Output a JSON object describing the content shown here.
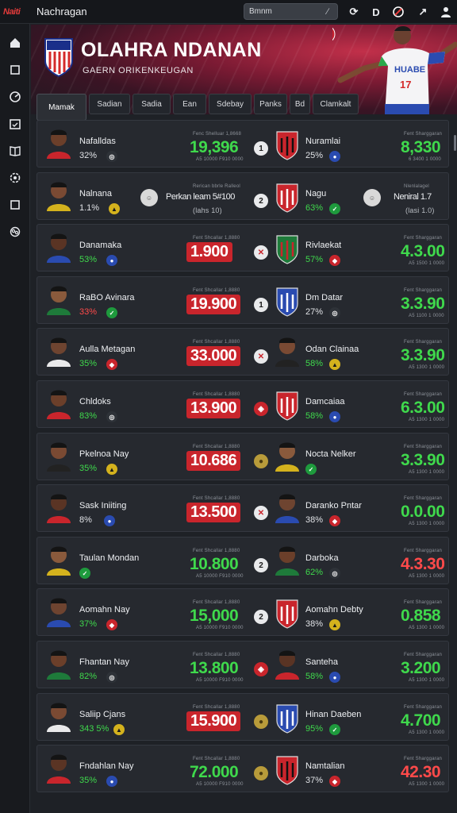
{
  "app": {
    "logo_text": "Naiti",
    "title": "Nachragan"
  },
  "search": {
    "value": "Bmnm"
  },
  "topbar_icons": [
    "refresh-icon",
    "d-icon",
    "brand-icon",
    "arrow-icon",
    "user-icon"
  ],
  "sidebar_icons": [
    "home-icon",
    "square-icon",
    "stats-icon",
    "calendar-icon",
    "book-icon",
    "settings-icon",
    "box-icon",
    "network-icon"
  ],
  "banner": {
    "title": "OLAHRA NDANAN",
    "subtitle": "GAERN ORIKENKEUGAN",
    "jersey_text": "HUABE",
    "jersey_number": "17"
  },
  "tabs": [
    "Mamak",
    "Sadian",
    "Sadia",
    "Ean",
    "Sdebay",
    "Panks",
    "Bd",
    "Clamkalt"
  ],
  "colors": {
    "green": "#3fd94c",
    "red": "#ff4a4a",
    "boxed_red": "#c9252c",
    "accent_blue": "#2a4bb0"
  },
  "matches": [
    {
      "left_name": "Nafalldas",
      "left_pct": "32%",
      "caption": "Fenc Shelluar 1,8668",
      "value": "19,396",
      "value_style": "green",
      "sub": "A5 10000 F910 0000",
      "mid": "1",
      "right_name": "Nuramlai",
      "right_pct": "25%",
      "right_caption": "Fent Sharggaran",
      "right_value": "8,330",
      "right_style": "green",
      "right_sub": "6 3400 1 0000"
    },
    {
      "left_name": "Nalnana",
      "left_pct": "1.1%",
      "caption": "Rerican bbrle Ralleol",
      "value": "Perkan leam 5#100",
      "value_style": "text",
      "sub": "(lahs 10)",
      "mid": "2",
      "right_name": "Nagu",
      "right_pct": "63%",
      "right_caption": "Nlenlalagel",
      "right_value": "Neniral 1.7",
      "right_style": "text",
      "right_sub": "(lasi 1.0)"
    },
    {
      "left_name": "Danamaka",
      "left_pct": "53%",
      "caption": "Fent Shcallar 1,8880",
      "value": "1.900",
      "value_style": "boxed",
      "sub": "",
      "mid": "x",
      "right_name": "Rivlaekat",
      "right_pct": "57%",
      "right_caption": "Fent Sharggaran",
      "right_value": "4.3.00",
      "right_style": "green",
      "right_sub": "A5 1500 1 0000"
    },
    {
      "left_name": "RaBO Avinara",
      "left_pct": "33%",
      "caption": "Fent Shcallar 1,8880",
      "value": "19.900",
      "value_style": "boxed",
      "sub": "",
      "mid": "1",
      "right_name": "Dm Datar",
      "right_pct": "27%",
      "right_caption": "Fent Sharggaran",
      "right_value": "3.3.90",
      "right_style": "green",
      "right_sub": "A5 1100 1 0000"
    },
    {
      "left_name": "Aulla Metagan",
      "left_pct": "35%",
      "caption": "Fent Shcallar 1,8880",
      "value": "33.000",
      "value_style": "boxed",
      "sub": "",
      "mid": "x",
      "right_name": "Odan Clainaa",
      "right_pct": "58%",
      "right_caption": "Fent Sharggaran",
      "right_value": "3.3.90",
      "right_style": "green",
      "right_sub": "A5 1300 1 0000"
    },
    {
      "left_name": "Chldoks",
      "left_pct": "83%",
      "caption": "Fent Shcallar 1,8880",
      "value": "13.900",
      "value_style": "boxed",
      "sub": "",
      "mid": "crest",
      "right_name": "Damcaiaa",
      "right_pct": "58%",
      "right_caption": "Fent Sharggaran",
      "right_value": "6.3.00",
      "right_style": "green",
      "right_sub": "A5 1300 1 0000"
    },
    {
      "left_name": "Pkelnoa Nay",
      "left_pct": "35%",
      "caption": "Fent Shcallar 1,8880",
      "value": "10.686",
      "value_style": "boxed",
      "sub": "",
      "mid": "ball",
      "right_name": "Nocta Nelker",
      "right_pct": "",
      "right_caption": "Fent Sharggaran",
      "right_value": "3.3.90",
      "right_style": "green",
      "right_sub": "A5 1300 1 0000"
    },
    {
      "left_name": "Sask Iniiting",
      "left_pct": "8%",
      "caption": "Fent Shcallar 1,8880",
      "value": "13.500",
      "value_style": "boxed",
      "sub": "",
      "mid": "x",
      "right_name": "Daranko Pntar",
      "right_pct": "38%",
      "right_caption": "Fent Sharggaran",
      "right_value": "0.0.00",
      "right_style": "green",
      "right_sub": "A5 1300 1 0000"
    },
    {
      "left_name": "Taulan Mondan",
      "left_pct": "",
      "caption": "Fent Shcallar 1,8880",
      "value": "10.800",
      "value_style": "green",
      "sub": "A5 10000 F910 0000",
      "mid": "2",
      "right_name": "Darboka",
      "right_pct": "62%",
      "right_caption": "Fent Sharggaran",
      "right_value": "4.3.30",
      "right_style": "red",
      "right_sub": "A5 1300 1 0000"
    },
    {
      "left_name": "Aomahn Nay",
      "left_pct": "37%",
      "caption": "Fent Shcallar 1,8880",
      "value": "15,000",
      "value_style": "green",
      "sub": "A5 10000 F910 0000",
      "mid": "2",
      "right_name": "Aomahn Debty",
      "right_pct": "38%",
      "right_caption": "Fent Sharggaran",
      "right_value": "0.858",
      "right_style": "green",
      "right_sub": "A5 1300 1 0000"
    },
    {
      "left_name": "Fhantan Nay",
      "left_pct": "82%",
      "caption": "Fent Shcallar 1,8880",
      "value": "13.800",
      "value_style": "green",
      "sub": "A5 10000 F910 0000",
      "mid": "crest",
      "right_name": "Santeha",
      "right_pct": "58%",
      "right_caption": "Fent Sharggaran",
      "right_value": "3.200",
      "right_style": "green",
      "right_sub": "A5 1300 1 0000"
    },
    {
      "left_name": "Saliip Cjans",
      "left_pct": "343 5%",
      "caption": "Fent Shcallar 1,8880",
      "value": "15.900",
      "value_style": "boxed",
      "sub": "",
      "mid": "ball",
      "right_name": "Hinan Daeben",
      "right_pct": "95%",
      "right_caption": "Fent Sharggaran",
      "right_value": "4.700",
      "right_style": "green",
      "right_sub": "A5 1300 1 0000"
    },
    {
      "left_name": "Fndahlan Nay",
      "left_pct": "35%",
      "caption": "Fent Shcallar 1,8880",
      "value": "72.000",
      "value_style": "green",
      "sub": "A5 10000 F910 0000",
      "mid": "ball",
      "right_name": "Namtalian",
      "right_pct": "37%",
      "right_caption": "Fent Sharggaran",
      "right_value": "42.30",
      "right_style": "red",
      "right_sub": "A5 1300 1 0000"
    }
  ]
}
